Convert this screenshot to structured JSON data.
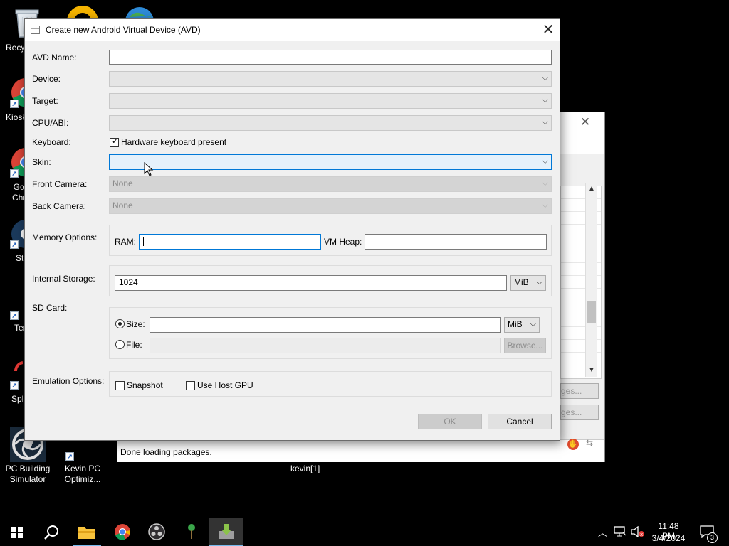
{
  "desktop": {
    "icons": [
      {
        "id": "recycle",
        "label": "Recyc"
      },
      {
        "id": "kiosk",
        "label": "Kiosk"
      },
      {
        "id": "chrome2",
        "label": "Go\nChr"
      },
      {
        "id": "steam",
        "label": "St"
      },
      {
        "id": "terminal",
        "label": "Ter"
      },
      {
        "id": "split",
        "label": "Spl"
      },
      {
        "id": "pcbuilding",
        "label": "PC Building\nSimulator"
      },
      {
        "id": "kevinpc",
        "label": "Kevin PC\nOptimiz..."
      }
    ],
    "kevin_label": "kevin[1]"
  },
  "back_window": {
    "status": "Done loading packages.",
    "btn1": "ges...",
    "btn2": "ges..."
  },
  "dialog": {
    "title": "Create new Android Virtual Device (AVD)",
    "close_glyph": "✕",
    "fields": {
      "avd_name": {
        "label": "AVD Name:",
        "value": ""
      },
      "device": {
        "label": "Device:",
        "value": ""
      },
      "target": {
        "label": "Target:",
        "value": ""
      },
      "cpu_abi": {
        "label": "CPU/ABI:",
        "value": ""
      },
      "keyboard": {
        "label": "Keyboard:",
        "checkbox_label": "Hardware keyboard present",
        "checked": true
      },
      "skin": {
        "label": "Skin:",
        "value": ""
      },
      "front_camera": {
        "label": "Front Camera:",
        "value": "None"
      },
      "back_camera": {
        "label": "Back Camera:",
        "value": "None"
      }
    },
    "memory": {
      "label": "Memory Options:",
      "ram_label": "RAM:",
      "ram_value": "",
      "vmheap_label": "VM Heap:",
      "vmheap_value": ""
    },
    "internal_storage": {
      "label": "Internal Storage:",
      "value": "1024",
      "unit": "MiB"
    },
    "sd_card": {
      "label": "SD Card:",
      "size_label": "Size:",
      "size_value": "",
      "size_unit": "MiB",
      "size_selected": true,
      "file_label": "File:",
      "file_value": "",
      "browse_label": "Browse..."
    },
    "emulation": {
      "label": "Emulation Options:",
      "snapshot_label": "Snapshot",
      "snapshot_checked": false,
      "host_gpu_label": "Use Host GPU",
      "host_gpu_checked": false
    },
    "ok_label": "OK",
    "cancel_label": "Cancel"
  },
  "taskbar": {
    "time": "11:48 PM",
    "date": "3/4/2024",
    "notification_count": "3"
  },
  "colors": {
    "focus": "#0078d7",
    "dialog_bg": "#f0f0f0",
    "desktop_bg": "#000000"
  }
}
